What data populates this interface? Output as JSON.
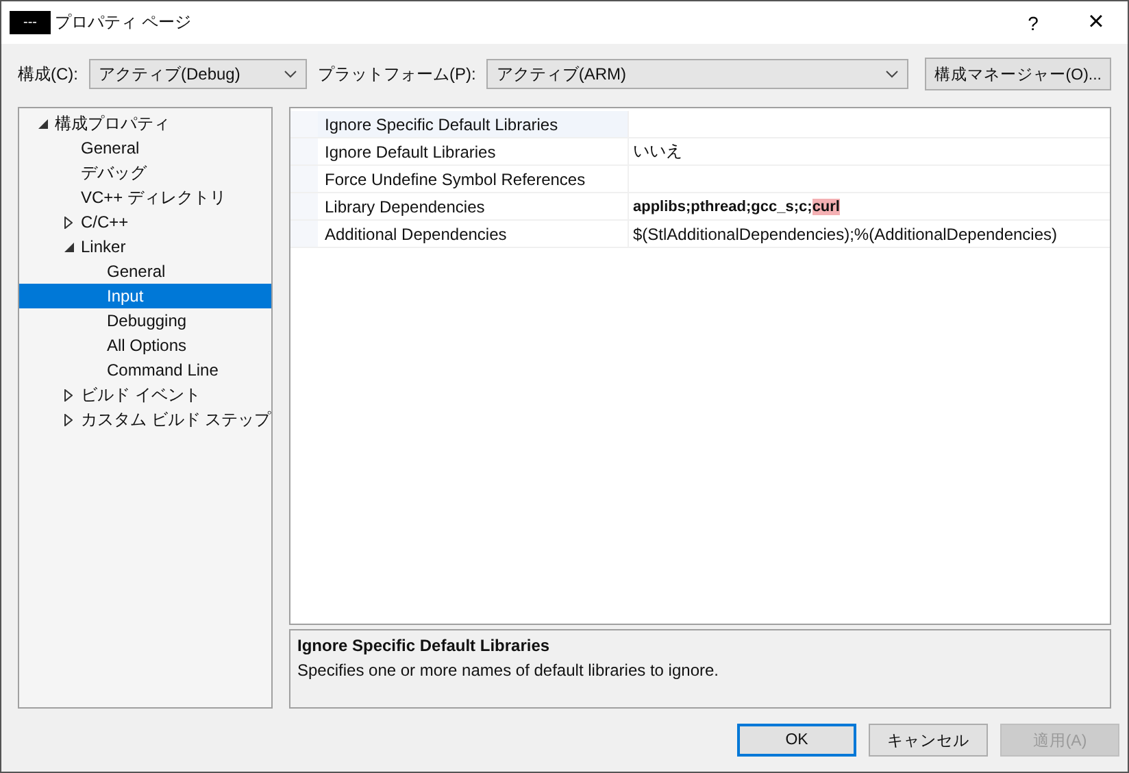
{
  "window": {
    "app_badge": "---",
    "title": "プロパティ ページ",
    "help": "?",
    "close": "×"
  },
  "toolbar": {
    "config_label": "構成(C):",
    "config_value": "アクティブ(Debug)",
    "platform_label": "プラットフォーム(P):",
    "platform_value": "アクティブ(ARM)",
    "manager_button": "構成マネージャー(O)..."
  },
  "tree": [
    {
      "label": "構成プロパティ",
      "expanded": true,
      "selected": false,
      "children": [
        {
          "label": "General",
          "selected": false
        },
        {
          "label": "デバッグ",
          "selected": false
        },
        {
          "label": "VC++ ディレクトリ",
          "selected": false
        },
        {
          "label": "C/C++",
          "expanded": false,
          "selected": false
        },
        {
          "label": "Linker",
          "expanded": true,
          "selected": false,
          "children": [
            {
              "label": "General",
              "selected": false
            },
            {
              "label": "Input",
              "selected": true
            },
            {
              "label": "Debugging",
              "selected": false
            },
            {
              "label": "All Options",
              "selected": false
            },
            {
              "label": "Command Line",
              "selected": false
            }
          ]
        },
        {
          "label": "ビルド イベント",
          "expanded": false,
          "selected": false
        },
        {
          "label": "カスタム ビルド ステップ",
          "expanded": false,
          "selected": false
        }
      ]
    }
  ],
  "properties": [
    {
      "name": "Ignore Specific Default Libraries",
      "selected": true
    },
    {
      "name": "Ignore Default Libraries",
      "value": "いいえ",
      "selected": false,
      "bold": false
    },
    {
      "name": "Force Undefine Symbol References",
      "selected": false
    },
    {
      "name": "Library Dependencies",
      "value": "applibs;pthread;gcc_s;c;",
      "highlighted": "curl",
      "selected": false,
      "bold": true
    },
    {
      "name": "Additional Dependencies",
      "value": "$(StlAdditionalDependencies);%(AdditionalDependencies)",
      "selected": false,
      "bold": false
    }
  ],
  "description": {
    "title": "Ignore Specific Default Libraries",
    "text": "Specifies one or more names of default libraries to ignore."
  },
  "buttons": [
    {
      "label": "OK",
      "kind": "default",
      "disabled": false
    },
    {
      "label": "キャンセル",
      "kind": "normal",
      "disabled": false
    },
    {
      "label": "適用(A)",
      "kind": "normal",
      "disabled": true
    }
  ]
}
